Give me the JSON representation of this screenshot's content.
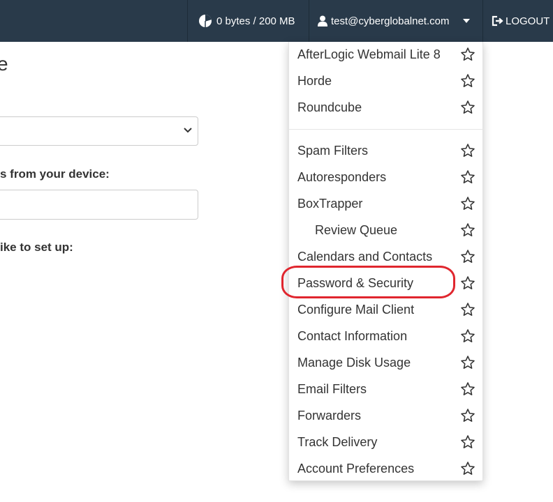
{
  "topbar": {
    "disk_usage": "0 bytes / 200 MB",
    "user_email": "test@cyberglobalnet.com",
    "logout_label": "LOGOUT"
  },
  "page": {
    "heading_fragment": "e",
    "device_label_fragment": "s from your device:",
    "setup_label_fragment": "ike to set up:"
  },
  "dropdown": {
    "webmail_items": [
      {
        "label": "AfterLogic Webmail Lite 8"
      },
      {
        "label": "Horde"
      },
      {
        "label": "Roundcube"
      }
    ],
    "tool_items": [
      {
        "label": "Spam Filters"
      },
      {
        "label": "Autoresponders"
      },
      {
        "label": "BoxTrapper"
      },
      {
        "label": "Review Queue",
        "indented": true
      },
      {
        "label": "Calendars and Contacts"
      },
      {
        "label": "Password & Security",
        "highlighted": true
      },
      {
        "label": "Configure Mail Client"
      },
      {
        "label": "Contact Information"
      },
      {
        "label": "Manage Disk Usage"
      },
      {
        "label": "Email Filters"
      },
      {
        "label": "Forwarders"
      },
      {
        "label": "Track Delivery"
      },
      {
        "label": "Account Preferences"
      }
    ]
  },
  "colors": {
    "topbar_bg": "#293a4a",
    "highlight_ring": "#e0262e"
  },
  "icons": {
    "disk": "pie-chart-icon",
    "user": "user-icon",
    "caret": "caret-down-icon",
    "logout": "logout-icon",
    "favorite": "star-outline-icon"
  }
}
